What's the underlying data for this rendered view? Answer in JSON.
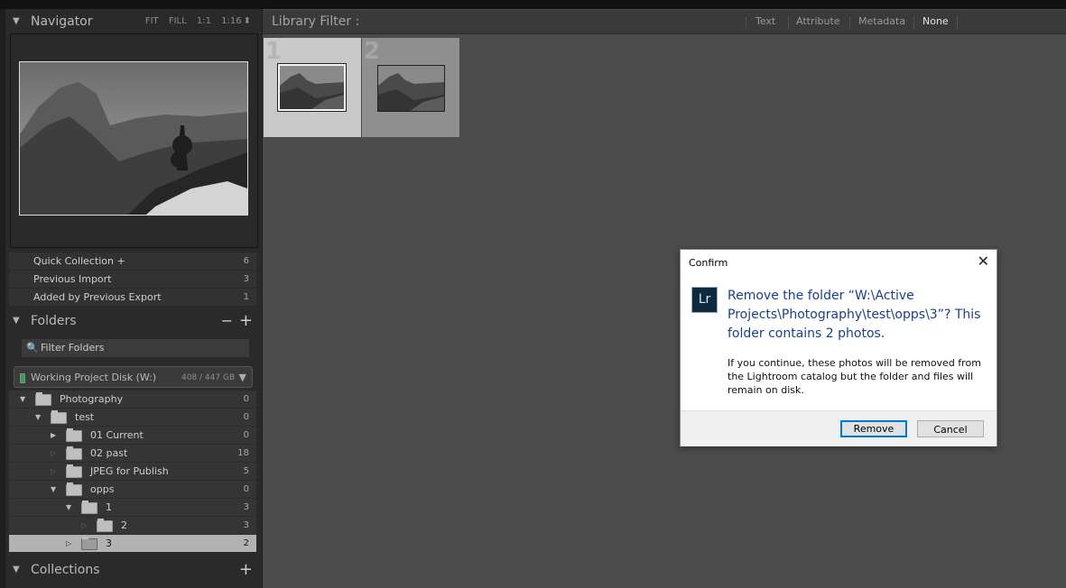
{
  "navigator": {
    "title": "Navigator",
    "options": [
      "FIT",
      "FILL",
      "1:1",
      "1:16"
    ]
  },
  "catalog_rows": [
    {
      "label": "Quick Collection  +",
      "count": "6"
    },
    {
      "label": "Previous Import",
      "count": "3"
    },
    {
      "label": "Added by Previous Export",
      "count": "1"
    }
  ],
  "folders": {
    "title": "Folders",
    "minus": "−",
    "plus": "+",
    "filter_placeholder": "Filter Folders",
    "volume": {
      "name": "Working Project Disk (W:)",
      "size": "408 / 447 GB"
    },
    "tree": [
      {
        "label": "Photography",
        "count": "0",
        "depth": 0,
        "expanded": true
      },
      {
        "label": "test",
        "count": "0",
        "depth": 1,
        "expanded": true
      },
      {
        "label": "01 Current",
        "count": "0",
        "depth": 2,
        "expanded": false
      },
      {
        "label": "02 past",
        "count": "18",
        "depth": 2,
        "expanded": false
      },
      {
        "label": "JPEG for Publish",
        "count": "5",
        "depth": 2,
        "expanded": false
      },
      {
        "label": "opps",
        "count": "0",
        "depth": 2,
        "expanded": true
      },
      {
        "label": "1",
        "count": "3",
        "depth": 3,
        "expanded": true
      },
      {
        "label": "2",
        "count": "3",
        "depth": 4,
        "expanded": false
      },
      {
        "label": "3",
        "count": "2",
        "depth": 3,
        "expanded": false,
        "selected": true
      }
    ]
  },
  "collections": {
    "title": "Collections",
    "plus": "+"
  },
  "library_filter": {
    "title": "Library Filter :",
    "options": [
      "Text",
      "Attribute",
      "Metadata",
      "None"
    ],
    "active": "None"
  },
  "grid": [
    {
      "number": "1",
      "selected": true
    },
    {
      "number": "2",
      "selected": false
    }
  ],
  "dialog": {
    "title": "Confirm",
    "close": "✕",
    "icon_text": "Lr",
    "message": "Remove the folder “W:\\Active Projects\\Photography\\test\\opps\\3”? This folder contains 2 photos.",
    "detail": "If you continue, these photos will be removed from the Lightroom catalog but the folder and files will remain on disk.",
    "buttons": {
      "remove": "Remove",
      "cancel": "Cancel"
    }
  },
  "colors": {
    "accent_button": "#0078d7",
    "dialog_text": "#1b3f8f"
  }
}
